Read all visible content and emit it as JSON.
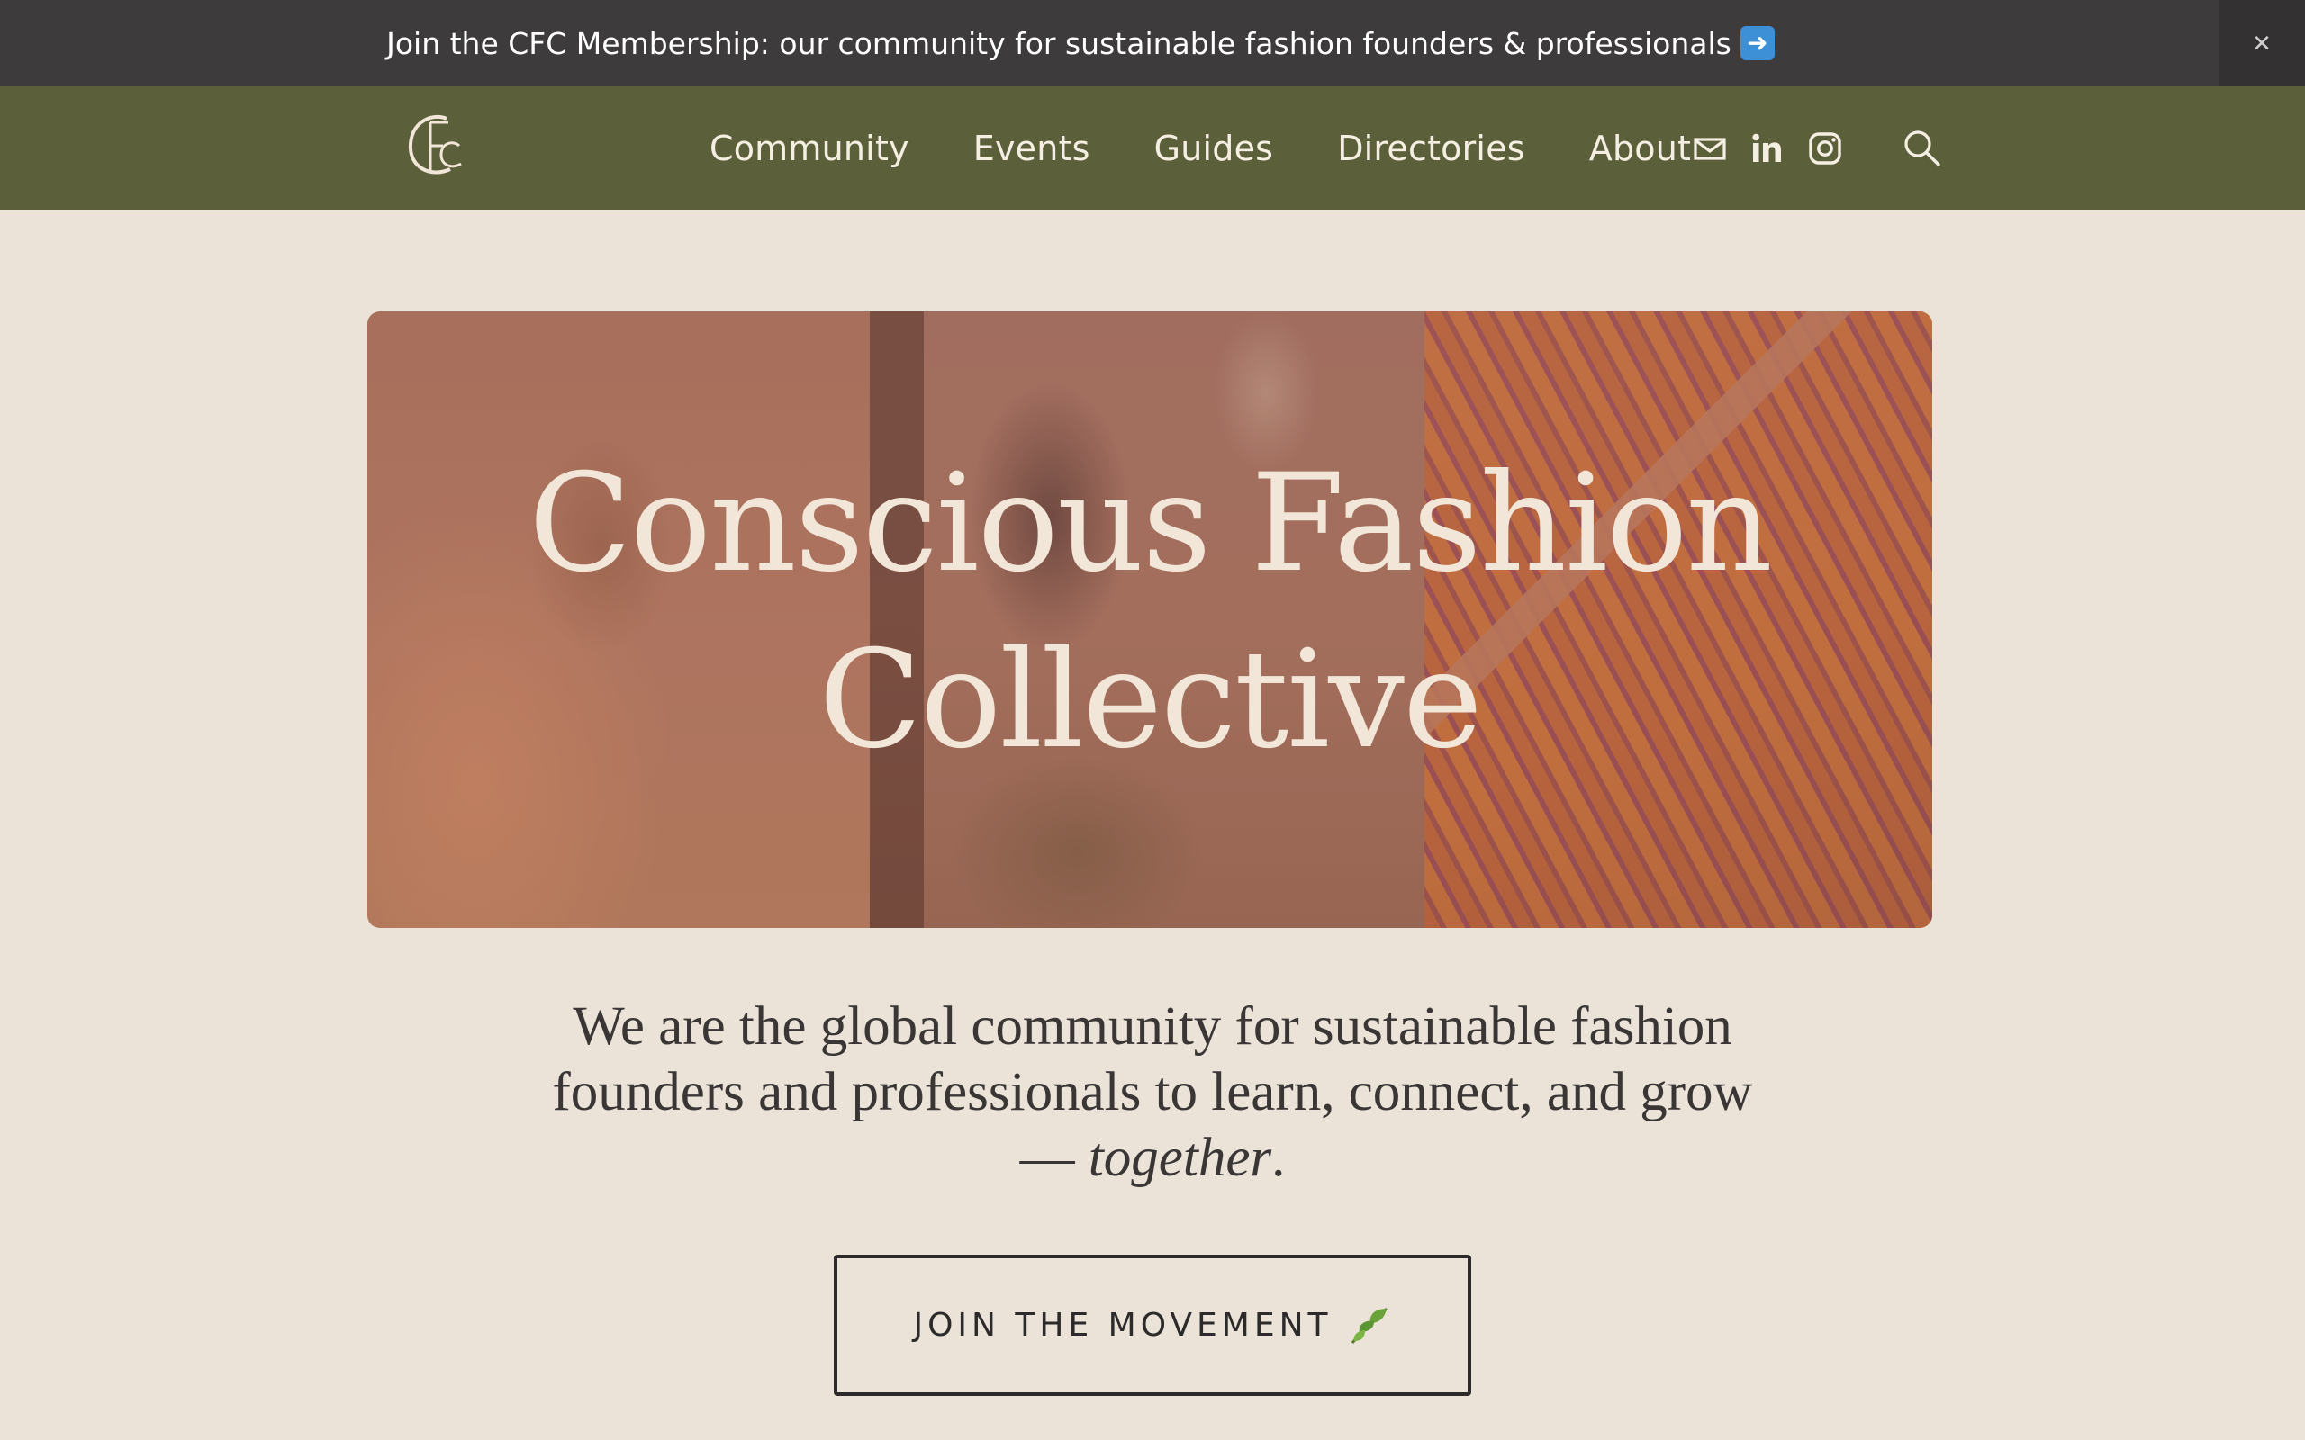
{
  "announcement": {
    "text": "Join the CFC Membership: our community for sustainable fashion founders & professionals",
    "arrow_icon": "right-arrow-emoji",
    "close_icon": "close-icon",
    "close_symbol": "✕"
  },
  "nav": {
    "logo_letters": "CFC",
    "items": [
      {
        "label": "Community"
      },
      {
        "label": "Events"
      },
      {
        "label": "Guides"
      },
      {
        "label": "Directories"
      },
      {
        "label": "About"
      }
    ],
    "icons": [
      "mail-icon",
      "linkedin-icon",
      "instagram-icon",
      "search-icon"
    ]
  },
  "hero": {
    "title_line1": "Conscious Fashion",
    "title_line2": "Collective"
  },
  "tagline": {
    "main": "We are the global community for sustainable fashion founders and professionals to learn, connect, and grow",
    "dash": "—",
    "emphasis": "together",
    "end": "."
  },
  "cta": {
    "label": "JOIN THE MOVEMENT",
    "icon": "leaf-emoji"
  },
  "colors": {
    "announcement_bg": "#3d3b3c",
    "nav_bg": "#5c603a",
    "page_bg": "#ebe3d7",
    "text_dark": "#3b3636"
  }
}
